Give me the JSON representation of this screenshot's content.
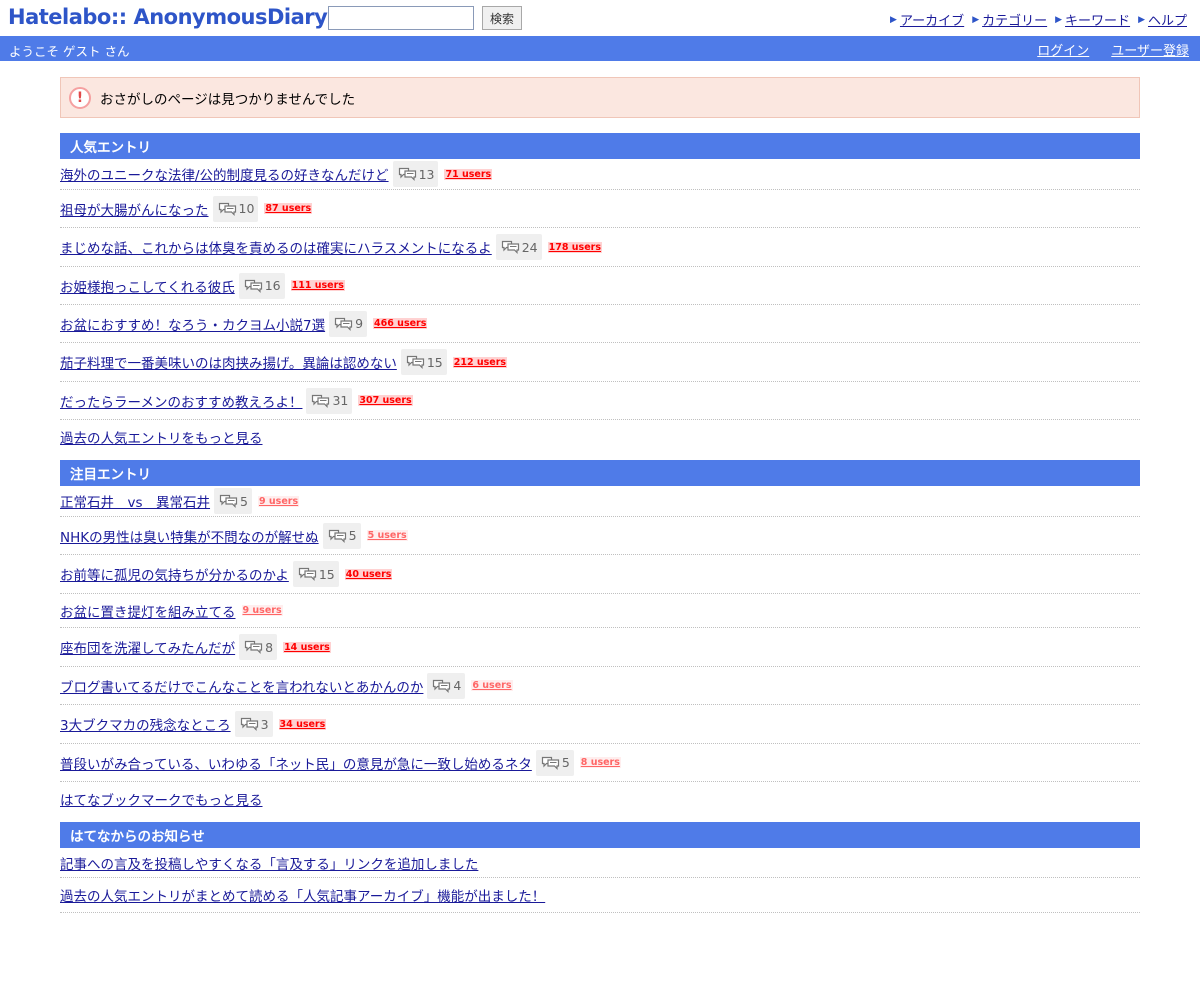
{
  "header": {
    "logo": "Hatelabo:: AnonymousDiary",
    "search_placeholder": "",
    "search_button": "検索",
    "nav": [
      "アーカイブ",
      "カテゴリー",
      "キーワード",
      "ヘルプ"
    ]
  },
  "welcome": {
    "text": "ようこそ ゲスト さん",
    "login": "ログイン",
    "register": "ユーザー登録"
  },
  "error_message": "おさがしのページは見つかりませんでした",
  "popular": {
    "title": "人気エントリ",
    "entries": [
      {
        "title": "海外のユニークな法律/公的制度見るの好きなんだけど",
        "comments": "13",
        "users": "71 users",
        "level": "hot"
      },
      {
        "title": "祖母が大腸がんになった",
        "comments": "10",
        "users": "87 users",
        "level": "hot"
      },
      {
        "title": "まじめな話、これからは体臭を責めるのは確実にハラスメントになるよ",
        "comments": "24",
        "users": "178 users",
        "level": "hot"
      },
      {
        "title": "お姫様抱っこしてくれる彼氏",
        "comments": "16",
        "users": "111 users",
        "level": "hot"
      },
      {
        "title": "お盆におすすめ！なろう・カクヨム小説7選",
        "comments": "9",
        "users": "466 users",
        "level": "hot"
      },
      {
        "title": "茄子料理で一番美味いのは肉挟み揚げ。異論は認めない",
        "comments": "15",
        "users": "212 users",
        "level": "hot"
      },
      {
        "title": "だったらラーメンのおすすめ教えろよ！",
        "comments": "31",
        "users": "307 users",
        "level": "hot"
      }
    ],
    "more": "過去の人気エントリをもっと見る"
  },
  "hot": {
    "title": "注目エントリ",
    "entries": [
      {
        "title": "正常石井　vs　異常石井",
        "comments": "5",
        "users": "9 users",
        "level": "mild"
      },
      {
        "title": "NHKの男性は臭い特集が不問なのが解せぬ",
        "comments": "5",
        "users": "5 users",
        "level": "mild"
      },
      {
        "title": "お前等に孤児の気持ちが分かるのかよ",
        "comments": "15",
        "users": "40 users",
        "level": "hot"
      },
      {
        "title": "お盆に置き提灯を組み立てる",
        "comments": "",
        "users": "9 users",
        "level": "mild"
      },
      {
        "title": "座布団を洗濯してみたんだが",
        "comments": "8",
        "users": "14 users",
        "level": "hot"
      },
      {
        "title": "ブログ書いてるだけでこんなことを言われないとあかんのか",
        "comments": "4",
        "users": "6 users",
        "level": "mild"
      },
      {
        "title": "3大ブクマカの残念なところ",
        "comments": "3",
        "users": "34 users",
        "level": "hot"
      },
      {
        "title": "普段いがみ合っている、いわゆる「ネット民」の意見が急に一致し始めるネタ",
        "comments": "5",
        "users": "8 users",
        "level": "mild"
      }
    ],
    "more": "はてなブックマークでもっと見る"
  },
  "news": {
    "title": "はてなからのお知らせ",
    "entries": [
      {
        "title": "記事への言及を投稿しやすくなる「言及する」リンクを追加しました"
      },
      {
        "title": "過去の人気エントリがまとめて読める「人気記事アーカイブ」機能が出ました！"
      }
    ]
  },
  "icons": {
    "comment": "comment-icon",
    "error": "exclamation-icon",
    "nav_arrow": "triangle-right-icon"
  },
  "colors": {
    "brand_blue": "#4f7be8",
    "link": "#1a1a99",
    "users_hot": "#ff0000",
    "users_mild": "#ff6666"
  }
}
